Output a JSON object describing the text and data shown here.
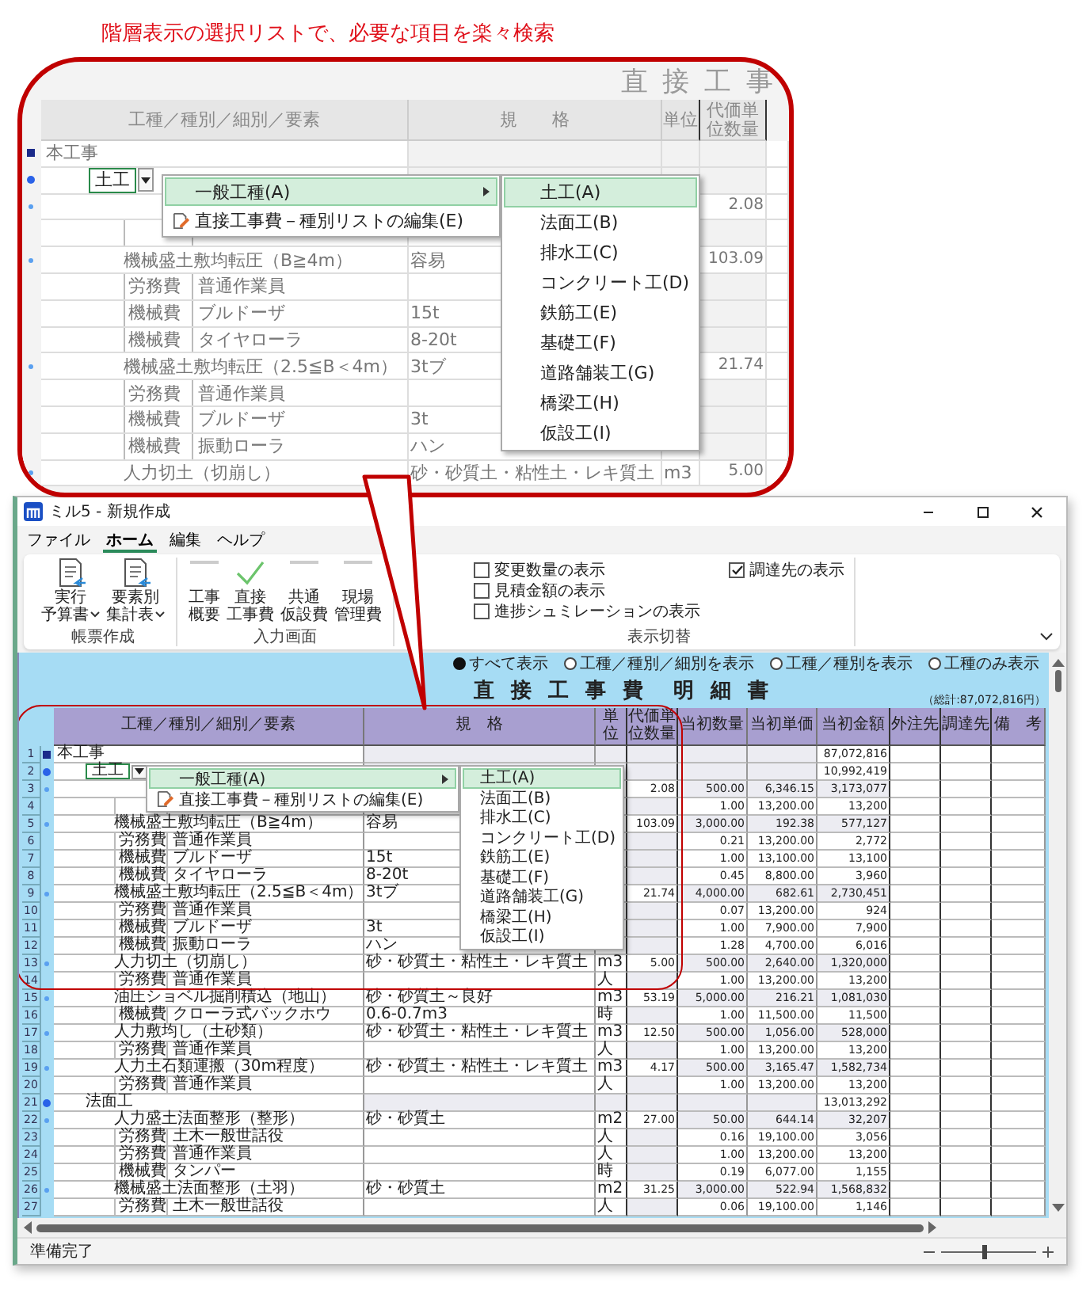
{
  "caption": "階層表示の選択リストで、必要な項目を楽々検索",
  "callout": {
    "sheet_title": "直 接 工 事",
    "columns": [
      "工種／種別／細別／要素",
      "規　　格",
      "単位",
      "代価単位数量"
    ],
    "rows": [
      {
        "kind": "project",
        "editing": false,
        "name": "本工事"
      },
      {
        "kind": "category",
        "editing": true,
        "name": "土工"
      },
      {
        "kind": "item",
        "editing": false,
        "unit_qty": "2.08"
      },
      {
        "kind": "element",
        "editing": false
      },
      {
        "kind": "item",
        "editing": false,
        "name": "機械盛土敷均転圧（B≧4m）",
        "spec": "容易",
        "unit_qty": "103.09"
      },
      {
        "kind": "element",
        "editing": false,
        "cost_type": "労務費",
        "name": "普通作業員"
      },
      {
        "kind": "element",
        "editing": false,
        "cost_type": "機械費",
        "name": "ブルドーザ",
        "spec": "15t"
      },
      {
        "kind": "element",
        "editing": false,
        "cost_type": "機械費",
        "name": "タイヤローラ",
        "spec": "8-20t"
      },
      {
        "kind": "item",
        "editing": false,
        "name": "機械盛土敷均転圧（2.5≦B＜4m）",
        "spec": "3tブ",
        "unit_qty": "21.74"
      },
      {
        "kind": "element",
        "editing": false,
        "cost_type": "労務費",
        "name": "普通作業員"
      },
      {
        "kind": "element",
        "editing": false,
        "cost_type": "機械費",
        "name": "ブルドーザ",
        "spec": "3t"
      },
      {
        "kind": "element",
        "editing": false,
        "cost_type": "機械費",
        "name": "振動ローラ",
        "spec": "ハン"
      },
      {
        "kind": "item",
        "editing": false,
        "name": "人力切土（切崩し）",
        "spec": "砂・砂質土・粘性土・レキ質土",
        "unit": "m3",
        "unit_qty": "5.00"
      }
    ],
    "menu": {
      "items": [
        {
          "label": "一般工種(A)",
          "kind": "submenu",
          "selected": true
        },
        {
          "label": "直接工事費－種別リストの編集(E)",
          "kind": "command",
          "selected": false
        }
      ],
      "submenu": [
        {
          "label": "土工(A)",
          "selected": true
        },
        {
          "label": "法面工(B)",
          "selected": false
        },
        {
          "label": "排水工(C)",
          "selected": false
        },
        {
          "label": "コンクリート工(D)",
          "selected": false
        },
        {
          "label": "鉄筋工(E)",
          "selected": false
        },
        {
          "label": "基礎工(F)",
          "selected": false
        },
        {
          "label": "道路舗装工(G)",
          "selected": false
        },
        {
          "label": "橋梁工(H)",
          "selected": false
        },
        {
          "label": "仮設工(I)",
          "selected": false
        }
      ]
    }
  },
  "window": {
    "title": "ミル5 - 新規作成"
  },
  "menu_bar": [
    {
      "label": "ファイル",
      "selected": false
    },
    {
      "label": "ホーム",
      "selected": true
    },
    {
      "label": "編集",
      "selected": false
    },
    {
      "label": "ヘルプ",
      "selected": false
    }
  ],
  "ribbon": {
    "groups": [
      {
        "label": "帳票作成",
        "buttons": [
          {
            "label_lines": [
              "実行",
              "予算書"
            ],
            "dropdown": true
          },
          {
            "label_lines": [
              "要素別",
              "集計表"
            ],
            "dropdown": true
          }
        ]
      },
      {
        "label": "入力画面",
        "buttons": [
          {
            "label_lines": [
              "工事",
              "概要"
            ],
            "selected": false
          },
          {
            "label_lines": [
              "直接",
              "工事費"
            ],
            "selected": true
          },
          {
            "label_lines": [
              "共通",
              "仮設費"
            ],
            "selected": false
          },
          {
            "label_lines": [
              "現場",
              "管理費"
            ],
            "selected": false
          }
        ]
      },
      {
        "label": "表示切替",
        "checkboxes": [
          {
            "label": "変更数量の表示",
            "checked": false
          },
          {
            "label": "見積金額の表示",
            "checked": false
          },
          {
            "label": "進捗シュミレーションの表示",
            "checked": false
          },
          {
            "label": "調達先の表示",
            "checked": true
          }
        ]
      }
    ]
  },
  "sheet": {
    "view_options": [
      {
        "label": "すべて表示",
        "selected": true
      },
      {
        "label": "工種／種別／細別を表示",
        "selected": false
      },
      {
        "label": "工種／種別を表示",
        "selected": false
      },
      {
        "label": "工種のみ表示",
        "selected": false
      }
    ],
    "title": "直 接 工 事 費　明 細 書",
    "total": "（総計:87,072,816円）",
    "columns": [
      "工種／種別／細別／要素",
      "規　格",
      "単位",
      "代価単位数量",
      "当初数量",
      "当初単価",
      "当初金額",
      "外注先",
      "調達先",
      "備　考"
    ],
    "rows": [
      {
        "num": "1",
        "kind": "project",
        "editing": false,
        "name": "本工事",
        "amount": "87,072,816"
      },
      {
        "num": "2",
        "kind": "category",
        "editing": true,
        "name": "土工",
        "amount": "10,992,419"
      },
      {
        "num": "3",
        "kind": "item",
        "editing": false,
        "unit_qty": "2.08",
        "qty": "500.00",
        "price": "6,346.15",
        "amount": "3,173,077"
      },
      {
        "num": "4",
        "kind": "element",
        "editing": false,
        "qty": "1.00",
        "price": "13,200.00",
        "amount": "13,200"
      },
      {
        "num": "5",
        "kind": "item",
        "editing": false,
        "name": "機械盛土敷均転圧（B≧4m）",
        "spec": "容易",
        "unit_qty": "103.09",
        "qty": "3,000.00",
        "price": "192.38",
        "amount": "577,127"
      },
      {
        "num": "6",
        "kind": "element",
        "editing": false,
        "cost_type": "労務費",
        "name": "普通作業員",
        "qty": "0.21",
        "price": "13,200.00",
        "amount": "2,772"
      },
      {
        "num": "7",
        "kind": "element",
        "editing": false,
        "cost_type": "機械費",
        "name": "ブルドーザ",
        "spec": "15t",
        "qty": "1.00",
        "price": "13,100.00",
        "amount": "13,100"
      },
      {
        "num": "8",
        "kind": "element",
        "editing": false,
        "cost_type": "機械費",
        "name": "タイヤローラ",
        "spec": "8-20t",
        "qty": "0.45",
        "price": "8,800.00",
        "amount": "3,960"
      },
      {
        "num": "9",
        "kind": "item",
        "editing": false,
        "name": "機械盛土敷均転圧（2.5≦B＜4m）",
        "spec": "3tブ",
        "unit_qty": "21.74",
        "qty": "4,000.00",
        "price": "682.61",
        "amount": "2,730,451"
      },
      {
        "num": "10",
        "kind": "element",
        "editing": false,
        "cost_type": "労務費",
        "name": "普通作業員",
        "qty": "0.07",
        "price": "13,200.00",
        "amount": "924"
      },
      {
        "num": "11",
        "kind": "element",
        "editing": false,
        "cost_type": "機械費",
        "name": "ブルドーザ",
        "spec": "3t",
        "qty": "1.00",
        "price": "7,900.00",
        "amount": "7,900"
      },
      {
        "num": "12",
        "kind": "element",
        "editing": false,
        "cost_type": "機械費",
        "name": "振動ローラ",
        "spec": "ハン",
        "qty": "1.28",
        "price": "4,700.00",
        "amount": "6,016"
      },
      {
        "num": "13",
        "kind": "item",
        "editing": false,
        "name": "人力切土（切崩し）",
        "spec": "砂・砂質土・粘性土・レキ質土",
        "unit": "m3",
        "unit_qty": "5.00",
        "qty": "500.00",
        "price": "2,640.00",
        "amount": "1,320,000"
      },
      {
        "num": "14",
        "kind": "element",
        "editing": false,
        "cost_type": "労務費",
        "name": "普通作業員",
        "unit": "人",
        "qty": "1.00",
        "price": "13,200.00",
        "amount": "13,200"
      },
      {
        "num": "15",
        "kind": "item",
        "editing": false,
        "name": "油圧ショベル掘削積込（地山）",
        "spec": "砂・砂質土～良好",
        "unit": "m3",
        "unit_qty": "53.19",
        "qty": "5,000.00",
        "price": "216.21",
        "amount": "1,081,030"
      },
      {
        "num": "16",
        "kind": "element",
        "editing": false,
        "cost_type": "機械費",
        "name": "クローラ式バックホウ",
        "spec": "0.6-0.7m3",
        "unit": "時",
        "qty": "1.00",
        "price": "11,500.00",
        "amount": "11,500"
      },
      {
        "num": "17",
        "kind": "item",
        "editing": false,
        "name": "人力敷均し（土砂類）",
        "spec": "砂・砂質土・粘性土・レキ質土",
        "unit": "m3",
        "unit_qty": "12.50",
        "qty": "500.00",
        "price": "1,056.00",
        "amount": "528,000"
      },
      {
        "num": "18",
        "kind": "element",
        "editing": false,
        "cost_type": "労務費",
        "name": "普通作業員",
        "unit": "人",
        "qty": "1.00",
        "price": "13,200.00",
        "amount": "13,200"
      },
      {
        "num": "19",
        "kind": "item",
        "editing": false,
        "name": "人力土石類運搬（30m程度）",
        "spec": "砂・砂質土・粘性土・レキ質土",
        "unit": "m3",
        "unit_qty": "4.17",
        "qty": "500.00",
        "price": "3,165.47",
        "amount": "1,582,734"
      },
      {
        "num": "20",
        "kind": "element",
        "editing": false,
        "cost_type": "労務費",
        "name": "普通作業員",
        "unit": "人",
        "qty": "1.00",
        "price": "13,200.00",
        "amount": "13,200"
      },
      {
        "num": "21",
        "kind": "category",
        "editing": false,
        "name": "法面工",
        "amount": "13,013,292"
      },
      {
        "num": "22",
        "kind": "item",
        "editing": false,
        "name": "人力盛土法面整形（整形）",
        "spec": "砂・砂質土",
        "unit": "m2",
        "unit_qty": "27.00",
        "qty": "50.00",
        "price": "644.14",
        "amount": "32,207"
      },
      {
        "num": "23",
        "kind": "element",
        "editing": false,
        "cost_type": "労務費",
        "name": "土木一般世話役",
        "unit": "人",
        "qty": "0.16",
        "price": "19,100.00",
        "amount": "3,056"
      },
      {
        "num": "24",
        "kind": "element",
        "editing": false,
        "cost_type": "労務費",
        "name": "普通作業員",
        "unit": "人",
        "qty": "1.00",
        "price": "13,200.00",
        "amount": "13,200"
      },
      {
        "num": "25",
        "kind": "element",
        "editing": false,
        "cost_type": "機械費",
        "name": "タンパー",
        "unit": "時",
        "qty": "0.19",
        "price": "6,077.00",
        "amount": "1,155"
      },
      {
        "num": "26",
        "kind": "item",
        "editing": false,
        "name": "機械盛土法面整形（土羽）",
        "spec": "砂・砂質土",
        "unit": "m2",
        "unit_qty": "31.25",
        "qty": "3,000.00",
        "price": "522.94",
        "amount": "1,568,832"
      },
      {
        "num": "27",
        "kind": "element",
        "editing": false,
        "cost_type": "労務費",
        "name": "土木一般世話役",
        "unit": "人",
        "qty": "0.06",
        "price": "19,100.00",
        "amount": "1,146"
      }
    ],
    "menu": {
      "items": [
        {
          "label": "一般工種(A)",
          "kind": "submenu",
          "selected": true
        },
        {
          "label": "直接工事費－種別リストの編集(E)",
          "kind": "command",
          "selected": false
        }
      ],
      "submenu": [
        {
          "label": "土工(A)",
          "selected": true
        },
        {
          "label": "法面工(B)",
          "selected": false
        },
        {
          "label": "排水工(C)",
          "selected": false
        },
        {
          "label": "コンクリート工(D)",
          "selected": false
        },
        {
          "label": "鉄筋工(E)",
          "selected": false
        },
        {
          "label": "基礎工(F)",
          "selected": false
        },
        {
          "label": "道路舗装工(G)",
          "selected": false
        },
        {
          "label": "橋梁工(H)",
          "selected": false
        },
        {
          "label": "仮設工(I)",
          "selected": false
        }
      ]
    }
  },
  "status_bar": {
    "text": "準備完了",
    "zoom": {
      "level": 0.45
    }
  }
}
